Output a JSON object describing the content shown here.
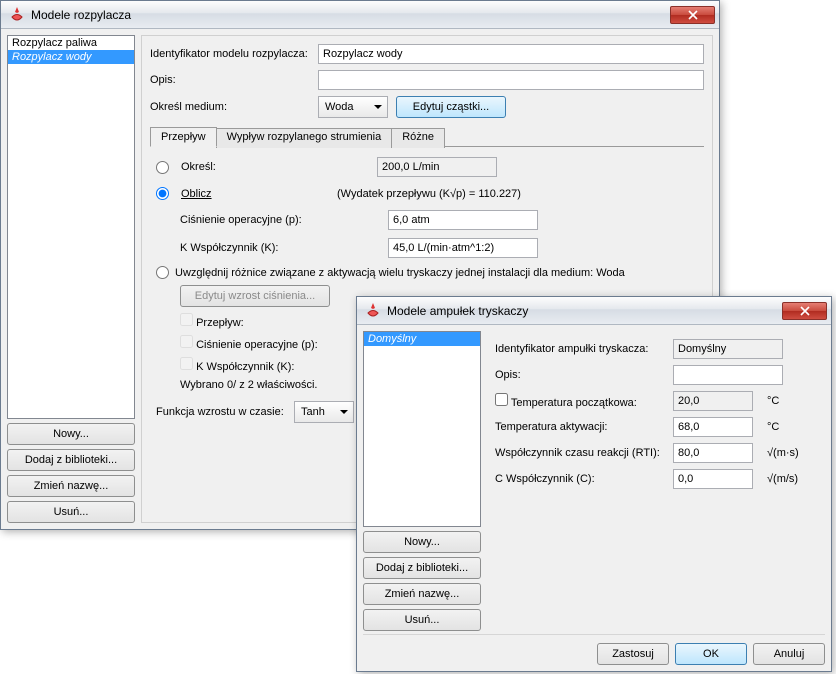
{
  "win1": {
    "title": "Modele rozpylacza",
    "list": {
      "items": [
        "Rozpylacz paliwa",
        "Rozpylacz wody"
      ],
      "selected": 1
    },
    "sidebtns": {
      "new": "Nowy...",
      "addlib": "Dodaj z biblioteki...",
      "rename": "Zmień nazwę...",
      "del": "Usuń..."
    },
    "form": {
      "id_label": "Identyfikator modelu rozpylacza:",
      "id_value": "Rozpylacz wody",
      "opis_label": "Opis:",
      "opis_value": "",
      "medium_label": "Określ medium:",
      "medium_value": "Woda",
      "edit_particles": "Edytuj cząstki..."
    },
    "tabs": {
      "t1": "Przepływ",
      "t2": "Wypływ rozpylanego strumienia",
      "t3": "Różne"
    },
    "flow": {
      "okresl": "Określ:",
      "okresl_value": "200,0 L/min",
      "oblicz": "Oblicz",
      "coef_note": "(Wydatek przepływu (K√p) = 110.227)",
      "cisn_label": "Ciśnienie operacyjne (p):",
      "cisn_value": "6,0 atm",
      "k_label": "K Współczynnik (K):",
      "k_value": "45,0 L/(min·atm^1:2)",
      "multi_label": "Uwzględnij różnice związane z aktywacją wielu tryskaczy jednej instalacji dla medium: Woda",
      "edit_pressure": "Edytuj wzrost ciśnienia...",
      "cb_przeplyw": "Przepływ:",
      "cb_cisn": "Ciśnienie operacyjne (p):",
      "cb_k": "K Współczynnik (K):",
      "summary": "Wybrano 0/ z 2 właściwości.",
      "func_label": "Funkcja wzrostu w czasie:",
      "func_value": "Tanh"
    }
  },
  "win2": {
    "title": "Modele ampułek tryskaczy",
    "list": {
      "items": [
        "Domyślny"
      ],
      "selected": 0
    },
    "sidebtns": {
      "new": "Nowy...",
      "addlib": "Dodaj z biblioteki...",
      "rename": "Zmień nazwę...",
      "del": "Usuń..."
    },
    "form": {
      "id_label": "Identyfikator ampułki tryskacza:",
      "id_value": "Domyślny",
      "opis_label": "Opis:",
      "opis_value": "",
      "tstart_label": "Temperatura początkowa:",
      "tstart_value": "20,0",
      "tstart_unit": "°C",
      "takt_label": "Temperatura aktywacji:",
      "takt_value": "68,0",
      "takt_unit": "°C",
      "rti_label": "Współczynnik czasu reakcji (RTI):",
      "rti_value": "80,0",
      "rti_unit": "√(m·s)",
      "c_label": "C Współczynnik (C):",
      "c_value": "0,0",
      "c_unit": "√(m/s)"
    },
    "dlg": {
      "apply": "Zastosuj",
      "ok": "OK",
      "cancel": "Anuluj"
    }
  }
}
